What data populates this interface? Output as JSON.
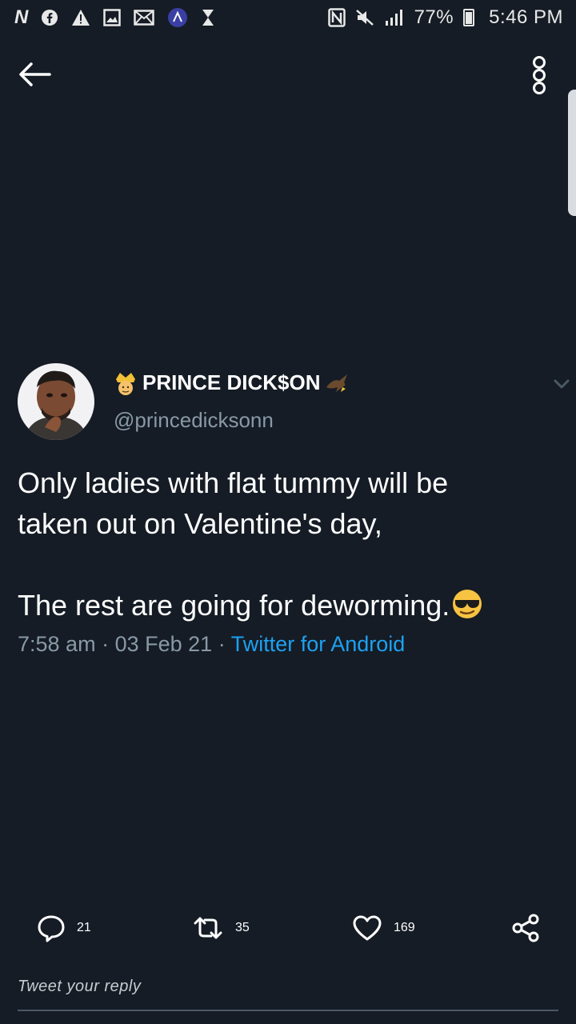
{
  "status_bar": {
    "icons": [
      "n-notification-icon",
      "facebook-icon",
      "warning-icon",
      "gallery-icon",
      "mail-icon",
      "app-icon",
      "hourglass-icon"
    ],
    "nfc_icon": "nfc-icon",
    "mute_icon": "mute-icon",
    "signal_icon": "signal-icon",
    "battery_percent": "77%",
    "time": "5:46 PM"
  },
  "app_bar": {
    "back_icon": "back-arrow-icon",
    "more_icon": "more-options-icon"
  },
  "tweet": {
    "display_name": "PRINCE DICK$ON",
    "handle": "@princedicksonn",
    "text_line_1": "Only ladies with flat tummy will be",
    "text_line_2": "taken out on Valentine's day,",
    "text_line_3": "The rest  are going for deworming.",
    "emoji": "😎",
    "time": "7:58 am",
    "separator": "·",
    "date": "03 Feb 21",
    "source": "Twitter for Android"
  },
  "actions": {
    "reply_count": "21",
    "retweet_count": "35",
    "like_count": "169"
  },
  "reply_placeholder": "Tweet your reply",
  "colors": {
    "background": "#151c25",
    "secondary_text": "#8899a6",
    "link": "#1da1f2"
  }
}
